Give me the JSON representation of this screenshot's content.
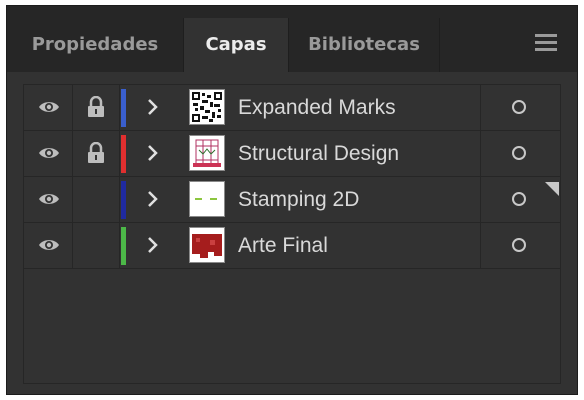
{
  "tabs": [
    {
      "label": "Propiedades",
      "active": false
    },
    {
      "label": "Capas",
      "active": true
    },
    {
      "label": "Bibliotecas",
      "active": false
    }
  ],
  "menu_icon": "hamburger-menu-icon",
  "layers": [
    {
      "name": "Expanded Marks",
      "visible": true,
      "locked": true,
      "color": "#3a5fcd",
      "thumbnail": "qr-pattern"
    },
    {
      "name": "Structural Design",
      "visible": true,
      "locked": true,
      "color": "#e02f2f",
      "thumbnail": "die-line"
    },
    {
      "name": "Stamping 2D",
      "visible": true,
      "locked": false,
      "color": "#1f2aa0",
      "thumbnail": "green-dashes"
    },
    {
      "name": "Arte Final",
      "visible": true,
      "locked": false,
      "color": "#4cb848",
      "thumbnail": "red-shape"
    }
  ],
  "colors": {
    "panel_bg": "#323232",
    "tabbar_bg": "#262626",
    "active_text": "#ececec",
    "inactive_text": "#9a9a9a"
  }
}
